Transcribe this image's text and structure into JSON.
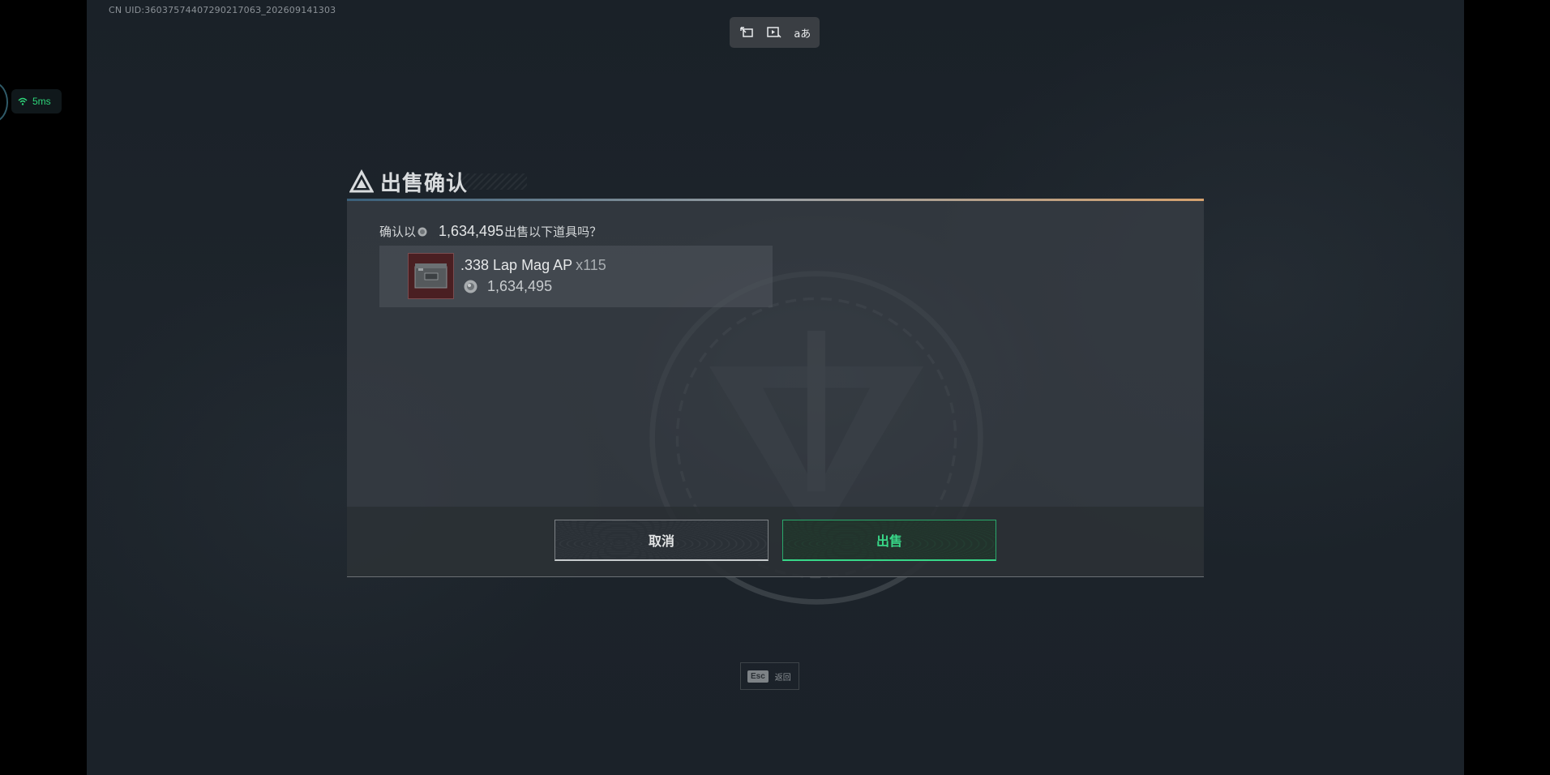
{
  "hud": {
    "uid": "CN UID:3603757440729021706З_202609141303",
    "ping": "5ms",
    "toolbar_icons": [
      "screen-share-icon",
      "video-record-icon",
      "translate-icon"
    ],
    "translate_glyph": "aあ"
  },
  "dialog": {
    "title": "出售确认",
    "confirm_prefix": "确认以",
    "confirm_amount": "1,634,495",
    "confirm_suffix": "出售以下道具吗？",
    "item": {
      "name": ".338 Lap Mag AP",
      "quantity": "x115",
      "price": "1,634,495"
    },
    "cancel_label": "取消",
    "sell_label": "出售"
  },
  "esc_hint": {
    "key": "Esc",
    "label": "返回"
  },
  "colors": {
    "accent_green": "#38d788",
    "ping_green": "#2ed67a",
    "item_bg_red": "#4a1f22"
  }
}
